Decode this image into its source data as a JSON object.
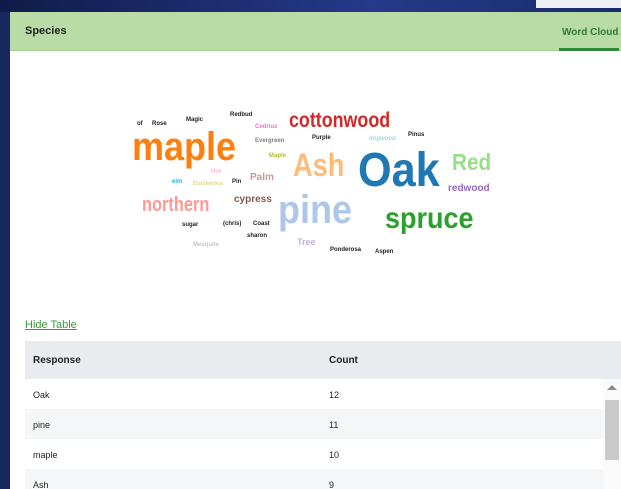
{
  "panel": {
    "title": "Species",
    "tab_label": "Word Cloud"
  },
  "word_cloud": [
    {
      "text": "of",
      "color": "#222222"
    },
    {
      "text": "Rose",
      "color": "#222222"
    },
    {
      "text": "Magic",
      "color": "#222222"
    },
    {
      "text": "Redbud",
      "color": "#222222"
    },
    {
      "text": "Cedrius",
      "color": "#e377c2"
    },
    {
      "text": "cottonwood",
      "color": "#d62728"
    },
    {
      "text": "Evergreen",
      "color": "#7f7f7f"
    },
    {
      "text": "Purple",
      "color": "#222222"
    },
    {
      "text": "dogwood",
      "color": "#9edae5"
    },
    {
      "text": "Pinus",
      "color": "#222222"
    },
    {
      "text": "maple",
      "color": "#ff7f0e"
    },
    {
      "text": "Maple",
      "color": "#bcbd22"
    },
    {
      "text": "Ash",
      "color": "#ffbb78"
    },
    {
      "text": "Oak",
      "color": "#1f77b4"
    },
    {
      "text": "Red",
      "color": "#98df8a"
    },
    {
      "text": "Hot",
      "color": "#f7b6d2"
    },
    {
      "text": "elm",
      "color": "#17becf"
    },
    {
      "text": "Eucleenea",
      "color": "#dbdb8d"
    },
    {
      "text": "Pin",
      "color": "#222222"
    },
    {
      "text": "Palm",
      "color": "#c49c94"
    },
    {
      "text": "redwood",
      "color": "#9467bd"
    },
    {
      "text": "northern",
      "color": "#ff9896"
    },
    {
      "text": "cypress",
      "color": "#8c564b"
    },
    {
      "text": "pine",
      "color": "#aec7e8"
    },
    {
      "text": "spruce",
      "color": "#2ca02c"
    },
    {
      "text": "sugar",
      "color": "#222222"
    },
    {
      "text": "(chris)",
      "color": "#222222"
    },
    {
      "text": "Coast",
      "color": "#222222"
    },
    {
      "text": "sharon",
      "color": "#222222"
    },
    {
      "text": "Tree",
      "color": "#c5b0d5"
    },
    {
      "text": "Mesquite",
      "color": "#c7c7c7"
    },
    {
      "text": "Ponderosa",
      "color": "#222222"
    },
    {
      "text": "Aspen",
      "color": "#222222"
    }
  ],
  "hide_table_label": "Hide Table",
  "table": {
    "columns": [
      "Response",
      "Count"
    ],
    "rows": [
      {
        "response": "Oak",
        "count": "12"
      },
      {
        "response": "pine",
        "count": "11"
      },
      {
        "response": "maple",
        "count": "10"
      },
      {
        "response": "Ash",
        "count": "9"
      }
    ]
  }
}
